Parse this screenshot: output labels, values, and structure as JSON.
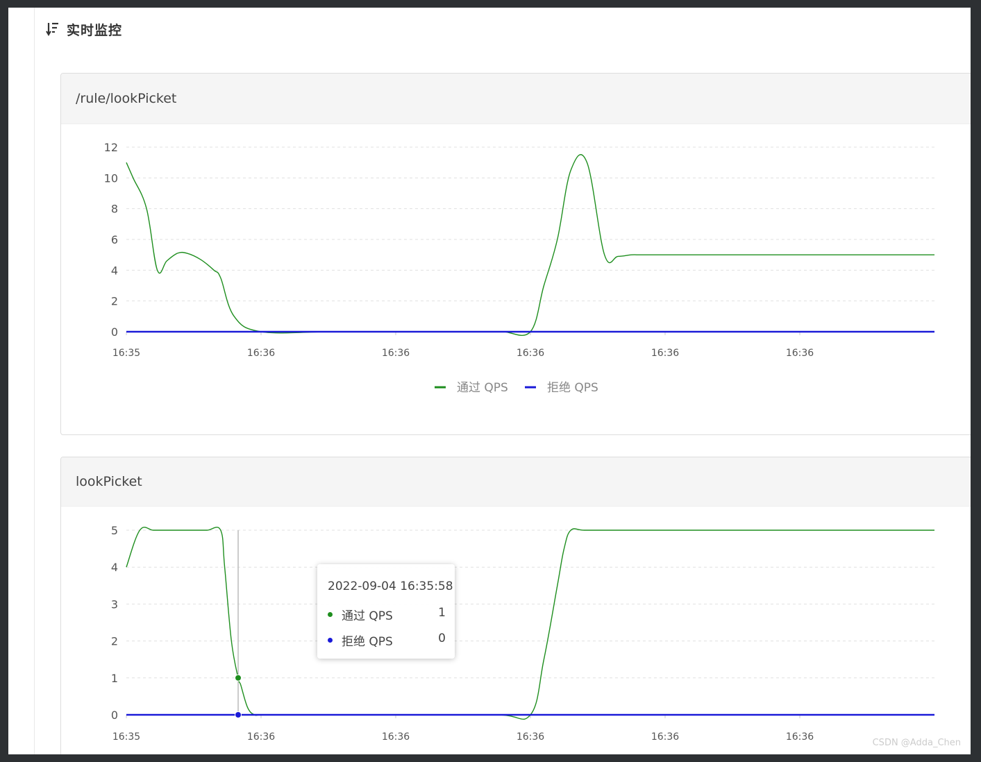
{
  "page": {
    "title": "实时监控",
    "watermark": "CSDN @Adda_Chen"
  },
  "colors": {
    "pass": "#1e8e1e",
    "block": "#1a1ad8",
    "grid": "#e0e0e0"
  },
  "icons": {
    "header": "sort-desc-icon"
  },
  "legend": {
    "pass": "通过 QPS",
    "block": "拒绝 QPS"
  },
  "tooltip": {
    "time": "2022-09-04 16:35:58",
    "rows": [
      {
        "name": "通过 QPS",
        "value": "1"
      },
      {
        "name": "拒绝 QPS",
        "value": "0"
      }
    ]
  },
  "chart_data": [
    {
      "type": "line",
      "title": "/rule/lookPicket",
      "x": [
        0,
        5,
        15,
        23,
        30,
        38,
        45,
        55,
        65,
        70,
        80,
        100,
        150,
        200,
        265,
        280,
        300,
        310,
        320,
        330,
        342,
        355,
        365,
        375,
        380,
        392,
        400,
        405,
        413,
        420,
        430,
        440,
        450,
        460,
        470,
        480,
        490,
        500,
        510,
        520,
        530,
        540,
        550,
        560,
        570,
        580,
        590,
        600
      ],
      "x_tick_labels": [
        "16:35",
        "16:36",
        "16:36",
        "16:36",
        "16:36",
        "16:36"
      ],
      "ylim": [
        0,
        12
      ],
      "y_ticks": [
        0,
        2,
        4,
        6,
        8,
        10,
        12
      ],
      "grid": true,
      "legend_position": "bottom",
      "series": [
        {
          "name": "通过 QPS",
          "values": [
            11,
            10,
            8,
            4,
            4.6,
            5.1,
            5.1,
            4.7,
            4,
            3.5,
            1,
            0,
            0,
            0,
            0,
            0,
            0,
            3,
            6,
            10.5,
            11,
            5,
            4.9,
            5,
            5,
            5,
            5,
            5,
            5,
            5,
            5,
            5,
            5,
            5,
            5,
            5,
            5,
            5,
            5,
            5,
            5,
            5,
            5,
            5,
            5,
            5,
            5,
            5
          ]
        },
        {
          "name": "拒绝 QPS",
          "values": [
            0,
            0,
            0,
            0,
            0,
            0,
            0,
            0,
            0,
            0,
            0,
            0,
            0,
            0,
            0,
            0,
            0,
            0,
            0,
            0,
            0,
            0,
            0,
            0,
            0,
            0,
            0,
            0,
            0,
            0,
            0,
            0,
            0,
            0,
            0,
            0,
            0,
            0,
            0,
            0,
            0,
            0,
            0,
            0,
            0,
            0,
            0,
            0
          ]
        }
      ]
    },
    {
      "type": "line",
      "title": "lookPicket",
      "x": [
        0,
        10,
        20,
        30,
        40,
        50,
        60,
        70,
        73,
        78,
        83,
        85,
        90,
        95,
        100,
        120,
        150,
        200,
        275,
        300,
        310,
        320,
        325,
        330,
        340,
        360,
        400,
        450,
        500,
        550,
        600
      ],
      "x_tick_labels": [
        "16:35",
        "16:36",
        "16:36",
        "16:36",
        "16:36",
        "16:36"
      ],
      "ylim": [
        0,
        5
      ],
      "y_ticks": [
        0,
        1,
        2,
        3,
        4,
        5
      ],
      "grid": true,
      "series": [
        {
          "name": "通过 QPS",
          "values": [
            4,
            5,
            5,
            5,
            5,
            5,
            5,
            5,
            4,
            2,
            1,
            0.8,
            0.2,
            0,
            0,
            0,
            0,
            0,
            0,
            0,
            1.5,
            3.5,
            4.5,
            5,
            5,
            5,
            5,
            5,
            5,
            5,
            5
          ]
        },
        {
          "name": "拒绝 QPS",
          "values": [
            0,
            0,
            0,
            0,
            0,
            0,
            0,
            0,
            0,
            0,
            0,
            0,
            0,
            0,
            0,
            0,
            0,
            0,
            0,
            0,
            0,
            0,
            0,
            0,
            0,
            0,
            0,
            0,
            0,
            0,
            0
          ]
        }
      ],
      "hover_index": 10
    }
  ]
}
